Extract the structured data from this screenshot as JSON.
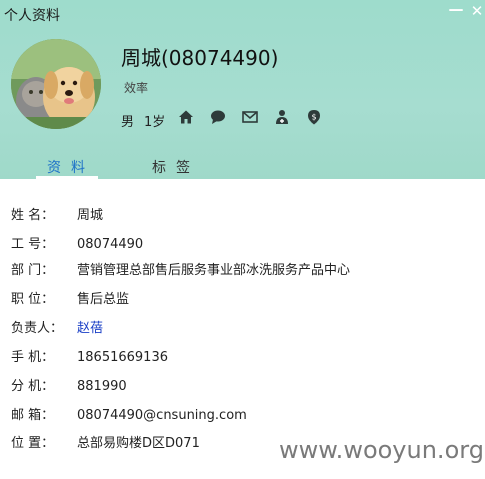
{
  "window": {
    "title": "个人资料",
    "minimize_glyph": "—",
    "close_glyph": "✕"
  },
  "profile": {
    "name": "周城(08074490)",
    "signature": "效率",
    "gender": "男",
    "age": "1岁",
    "action_icons": [
      "home-icon",
      "chat-bubble-icon",
      "mail-icon",
      "add-contact-icon",
      "location-pin-icon"
    ]
  },
  "tabs": [
    {
      "label": "资料",
      "active": true
    },
    {
      "label": "标签",
      "active": false
    }
  ],
  "details": [
    {
      "label": "姓  名：",
      "value": "周城"
    },
    {
      "label": "工  号：",
      "value": "08074490"
    },
    {
      "label": "部  门：",
      "value": "营销管理总部售后服务事业部冰洗服务产品中心"
    },
    {
      "label": "职  位：",
      "value": "售后总监"
    },
    {
      "label": "负责人：",
      "value": "赵蓓",
      "link": true
    },
    {
      "label": "手  机：",
      "value": "18651669136"
    },
    {
      "label": "分  机：",
      "value": "881990"
    },
    {
      "label": "邮  箱：",
      "value": "08074490@cnsuning.com"
    },
    {
      "label": "位  置：",
      "value": "总部易购楼D区D071"
    }
  ],
  "watermark": "www.wooyun.org",
  "colors": {
    "header_bg": "#a6ddd0",
    "active_tab": "#1e72c8",
    "link": "#1a3fc6"
  }
}
